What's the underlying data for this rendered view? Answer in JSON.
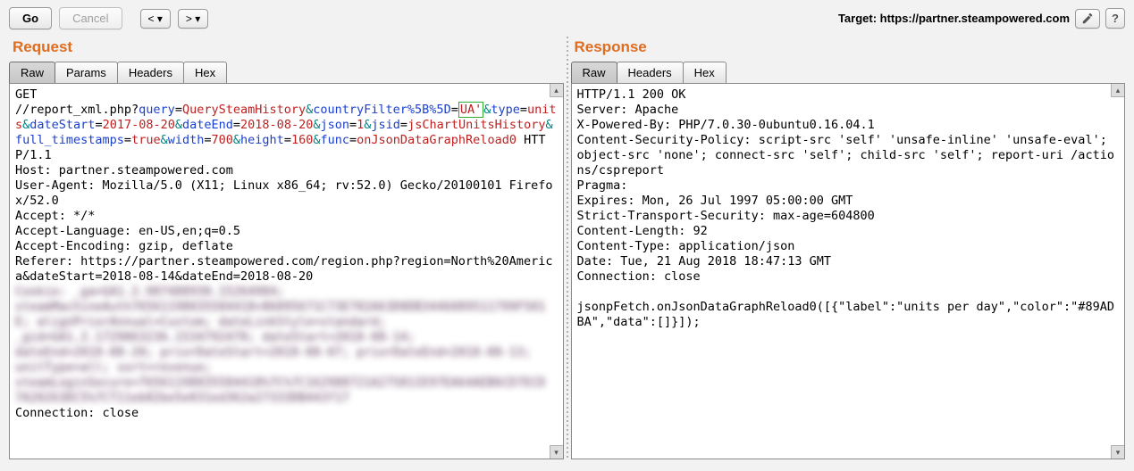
{
  "toolbar": {
    "go": "Go",
    "cancel": "Cancel",
    "back": "<  ▾",
    "fwd": ">  ▾",
    "target_prefix": "Target: ",
    "target_url": "https://partner.steampowered.com"
  },
  "request": {
    "title": "Request",
    "tabs": {
      "raw": "Raw",
      "params": "Params",
      "headers": "Headers",
      "hex": "Hex"
    },
    "method": "GET",
    "path": "//report_xml.php?",
    "params": {
      "query_k": "query",
      "query_v": "QuerySteamHistory",
      "cf_k": "countryFilter%5B%5D",
      "cf_v": "UA'",
      "type_k": "type",
      "type_v": "units",
      "ds_k": "dateStart",
      "ds_v": "2017-08-20",
      "de_k": "dateEnd",
      "de_v": "2018-08-20",
      "json_k": "json",
      "json_v": "1",
      "jsid_k": "jsid",
      "jsid_v": "jsChartUnitsHistory",
      "ft_k": "full_timestamps",
      "ft_v": "true",
      "w_k": "width",
      "w_v": "700",
      "h_k": "height",
      "h_v": "160",
      "func_k": "func",
      "func_v": "onJsonDataGraphReload0"
    },
    "tail_lines": [
      " HTTP/1.1",
      "Host: partner.steampowered.com",
      "User-Agent: Mozilla/5.0 (X11; Linux x86_64; rv:52.0) Gecko/20100101 Firefox/52.0",
      "Accept: */*",
      "Accept-Language: en-US,en;q=0.5",
      "Accept-Encoding: gzip, deflate",
      "Referer: https://partner.steampowered.com/region.php?region=North%20America&dateStart=2018-08-14&dateEnd=2018-08-20"
    ],
    "blur_lines": [
      "Cookie: _ga=GA1.2.987488930.15264984;",
      "steamMachineAuth76561198035584418=86095671C73E782A63D0DB3446089511799F501",
      "E; alignPriorAnnual=Custom; dateLinkStyle=standard;",
      "_gid=GA1.2.1729063236.1534792478; dateStart=2018-08-14;",
      "dateEnd=2018-08-20; priorDateStart=2018-08-07; priorDateEnd=2018-08-13;",
      "unitType=all; sort=revenue;",
      "steamLoginSecure=76561198035584418%7C%7C162988721A27581IE97EA64AEB6CD7ECD",
      "7A20263DC5%7CT11eb82be5e031ed362a27333DB443f17"
    ],
    "conn_close": "Connection: close"
  },
  "response": {
    "title": "Response",
    "tabs": {
      "raw": "Raw",
      "headers": "Headers",
      "hex": "Hex"
    },
    "lines": [
      "HTTP/1.1 200 OK",
      "Server: Apache",
      "X-Powered-By: PHP/7.0.30-0ubuntu0.16.04.1",
      "Content-Security-Policy: script-src 'self' 'unsafe-inline' 'unsafe-eval'; object-src 'none'; connect-src 'self'; child-src 'self'; report-uri /actions/cspreport",
      "Pragma: ",
      "Expires: Mon, 26 Jul 1997 05:00:00 GMT",
      "Strict-Transport-Security: max-age=604800",
      "Content-Length: 92",
      "Content-Type: application/json",
      "Date: Tue, 21 Aug 2018 18:47:13 GMT",
      "Connection: close",
      "",
      "jsonpFetch.onJsonDataGraphReload0([{\"label\":\"units per day\",\"color\":\"#89ADBA\",\"data\":[]}]);"
    ]
  }
}
